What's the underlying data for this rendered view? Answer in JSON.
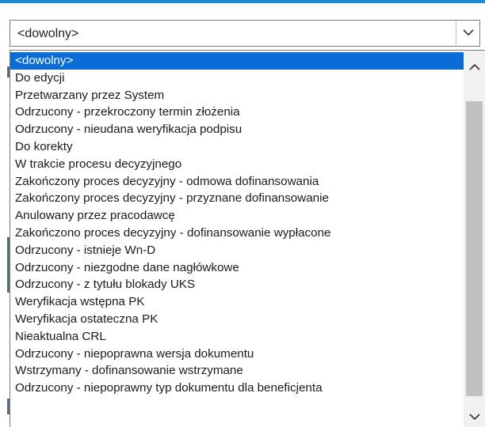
{
  "select": {
    "value": "<dowolny>",
    "arrow_icon": "chevron-down-icon"
  },
  "dropdown": {
    "options": [
      {
        "label": "<dowolny>",
        "selected": true
      },
      {
        "label": "Do edycji",
        "selected": false
      },
      {
        "label": "Przetwarzany przez System",
        "selected": false
      },
      {
        "label": "Odrzucony - przekroczony termin złożenia",
        "selected": false
      },
      {
        "label": "Odrzucony - nieudana weryfikacja podpisu",
        "selected": false
      },
      {
        "label": "Do korekty",
        "selected": false
      },
      {
        "label": "W trakcie procesu decyzyjnego",
        "selected": false
      },
      {
        "label": "Zakończony proces decyzyjny - odmowa dofinansowania",
        "selected": false
      },
      {
        "label": "Zakończony proces decyzyjny - przyznane dofinansowanie",
        "selected": false
      },
      {
        "label": "Anulowany przez pracodawcę",
        "selected": false
      },
      {
        "label": "Zakończono proces decyzyjny - dofinansowanie wypłacone",
        "selected": false
      },
      {
        "label": "Odrzucony - istnieje Wn-D",
        "selected": false
      },
      {
        "label": "Odrzucony - niezgodne dane nagłówkowe",
        "selected": false
      },
      {
        "label": "Odrzucony - z tytułu blokady UKS",
        "selected": false
      },
      {
        "label": "Weryfikacja wstępna PK",
        "selected": false
      },
      {
        "label": "Weryfikacja ostateczna PK",
        "selected": false
      },
      {
        "label": "Nieaktualna CRL",
        "selected": false
      },
      {
        "label": "Odrzucony - niepoprawna wersja dokumentu",
        "selected": false
      },
      {
        "label": "Wstrzymany - dofinansowanie wstrzymane",
        "selected": false
      },
      {
        "label": "Odrzucony - niepoprawny typ dokumentu dla beneficjenta",
        "selected": false
      }
    ],
    "scroll_up_icon": "chevron-up-icon",
    "scroll_down_icon": "chevron-down-icon"
  },
  "colors": {
    "accent": "#1f8ad6",
    "selected_bg": "#0a6dd6",
    "selected_text": "#ffffff",
    "scroll_thumb": "#c1c1c1"
  }
}
